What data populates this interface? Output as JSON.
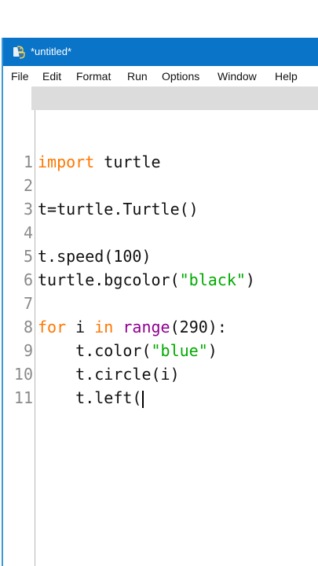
{
  "window": {
    "title": "*untitled*",
    "icon": "python-idle-icon"
  },
  "menu": {
    "items": [
      "File",
      "Edit",
      "Format",
      "Run",
      "Options",
      "Window",
      "Help"
    ]
  },
  "editor": {
    "line_numbers": [
      "1",
      "2",
      "3",
      "4",
      "5",
      "6",
      "7",
      "8",
      "9",
      "10",
      "11"
    ],
    "lines": [
      "import turtle",
      "",
      "t=turtle.Turtle()",
      "",
      "t.speed(100)",
      "turtle.bgcolor(\"black\")",
      "",
      "for i in range(290):",
      "    t.color(\"blue\")",
      "    t.circle(i)",
      "    t.left("
    ]
  },
  "colors": {
    "titlebar": "#0a74c8",
    "keyword": "#ff7700",
    "builtin": "#900090",
    "string": "#00aa00",
    "line_number": "#8a8a8a"
  }
}
